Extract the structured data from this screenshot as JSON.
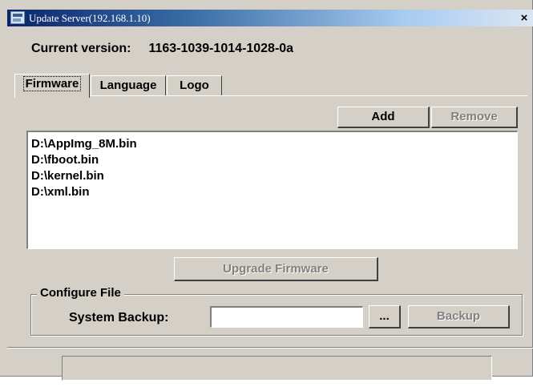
{
  "window": {
    "title": "Update Server(192.168.1.10)",
    "close_glyph": "×"
  },
  "version": {
    "label": "Current version:",
    "value": "1163-1039-1014-1028-0a"
  },
  "tabs": [
    {
      "label": "Firmware",
      "active": true
    },
    {
      "label": "Language",
      "active": false
    },
    {
      "label": "Logo",
      "active": false
    }
  ],
  "firmware": {
    "add_label": "Add",
    "remove_label": "Remove",
    "files": [
      "D:\\AppImg_8M.bin",
      "D:\\fboot.bin",
      "D:\\kernel.bin",
      "D:\\xml.bin"
    ],
    "upgrade_label": "Upgrade Firmware"
  },
  "configure": {
    "group_label": "Configure File",
    "system_backup_label": "System Backup:",
    "path_value": "",
    "browse_label": "...",
    "backup_label": "Backup"
  },
  "icons": {
    "app_icon": "app-icon",
    "close_icon": "close-icon"
  },
  "colors": {
    "dialog_bg": "#d4d0c8",
    "title_start": "#0a246a",
    "title_end": "#a6caf0",
    "disabled_text": "#808080"
  }
}
